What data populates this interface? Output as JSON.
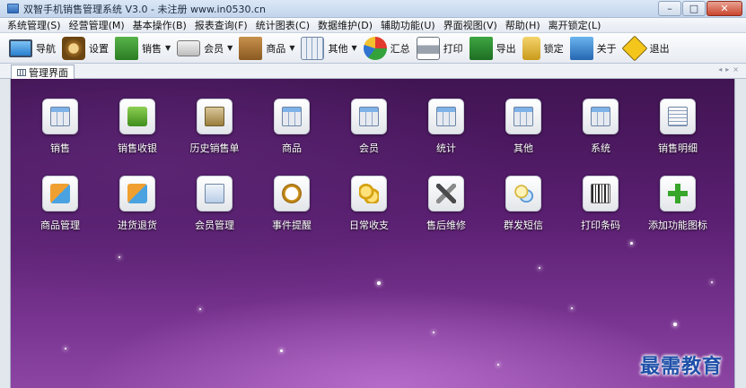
{
  "window": {
    "title": "双智手机销售管理系统 V3.0 - 未注册 www.in0530.cn",
    "minimize_glyph": "–",
    "maximize_glyph": "□",
    "close_glyph": "✕"
  },
  "menu": [
    "系统管理(S)",
    "经营管理(M)",
    "基本操作(B)",
    "报表查询(F)",
    "统计图表(C)",
    "数据维护(D)",
    "辅助功能(U)",
    "界面视图(V)",
    "帮助(H)",
    "离开锁定(L)"
  ],
  "toolbar": {
    "nav": "导航",
    "settings": "设置",
    "sales": "销售",
    "member": "会员",
    "product": "商品",
    "other": "其他",
    "summary": "汇总",
    "print": "打印",
    "export": "导出",
    "lock": "锁定",
    "about": "关于",
    "exit": "退出",
    "caret": "▼"
  },
  "tabs": {
    "active": "管理界面",
    "prev": "◂",
    "next": "▸",
    "close": "×"
  },
  "tiles_row1": [
    "销售",
    "销售收银",
    "历史销售单",
    "商品",
    "会员",
    "统计",
    "其他",
    "系统",
    "销售明细"
  ],
  "tiles_row2": [
    "商品管理",
    "进货退货",
    "会员管理",
    "事件提醒",
    "日常收支",
    "售后维修",
    "群发短信",
    "打印条码",
    "添加功能图标"
  ],
  "watermark": "最需教育"
}
